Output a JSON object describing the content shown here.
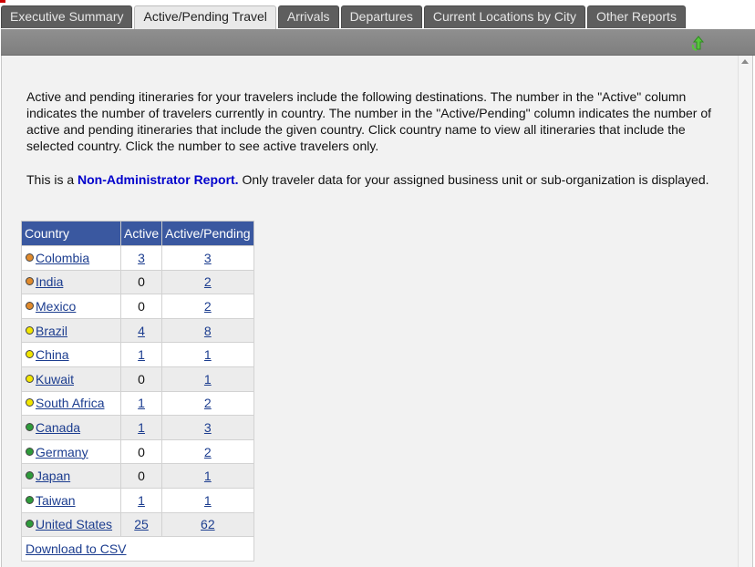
{
  "tabs": [
    {
      "label": "Executive Summary",
      "active": false
    },
    {
      "label": "Active/Pending Travel",
      "active": true
    },
    {
      "label": "Arrivals",
      "active": false
    },
    {
      "label": "Departures",
      "active": false
    },
    {
      "label": "Current Locations by City",
      "active": false
    },
    {
      "label": "Other Reports",
      "active": false
    }
  ],
  "intro": "Active and pending itineraries for your travelers include the following destinations. The number in the \"Active\" column indicates the number of travelers currently in country. The number in the \"Active/Pending\" column indicates the number of active and pending itineraries that include the given country. Click country name to view all itineraries that include the selected country. Click the number to see active travelers only.",
  "note": {
    "prefix": "This is a ",
    "strong": "Non-Administrator Report.",
    "suffix": " Only traveler data for your assigned business unit or sub-organization is displayed."
  },
  "table": {
    "headers": {
      "country": "Country",
      "active": "Active",
      "active_pending": "Active/Pending"
    },
    "rows": [
      {
        "country": "Colombia",
        "active": "3",
        "active_pending": "3",
        "risk_color": "#e08a2c"
      },
      {
        "country": "India",
        "active": "0",
        "active_pending": "2",
        "risk_color": "#e08a2c"
      },
      {
        "country": "Mexico",
        "active": "0",
        "active_pending": "2",
        "risk_color": "#e08a2c"
      },
      {
        "country": "Brazil",
        "active": "4",
        "active_pending": "8",
        "risk_color": "#f2e600"
      },
      {
        "country": "China",
        "active": "1",
        "active_pending": "1",
        "risk_color": "#f2e600"
      },
      {
        "country": "Kuwait",
        "active": "0",
        "active_pending": "1",
        "risk_color": "#f2e600"
      },
      {
        "country": "South Africa",
        "active": "1",
        "active_pending": "2",
        "risk_color": "#f2e600"
      },
      {
        "country": "Canada",
        "active": "1",
        "active_pending": "3",
        "risk_color": "#2e9b3a"
      },
      {
        "country": "Germany",
        "active": "0",
        "active_pending": "2",
        "risk_color": "#2e9b3a"
      },
      {
        "country": "Japan",
        "active": "0",
        "active_pending": "1",
        "risk_color": "#2e9b3a"
      },
      {
        "country": "Taiwan",
        "active": "1",
        "active_pending": "1",
        "risk_color": "#2e9b3a"
      },
      {
        "country": "United States",
        "active": "25",
        "active_pending": "62",
        "risk_color": "#2e9b3a"
      }
    ],
    "download_label": "Download to CSV"
  },
  "icons": {
    "toolbar": "refresh-arrow-icon"
  },
  "colors": {
    "header_bg": "#3a58a0",
    "toolbar_bg": "#878787",
    "tab_bg": "#5e5e5e",
    "link": "#1c3d8f",
    "admin_note": "#0000cc"
  }
}
